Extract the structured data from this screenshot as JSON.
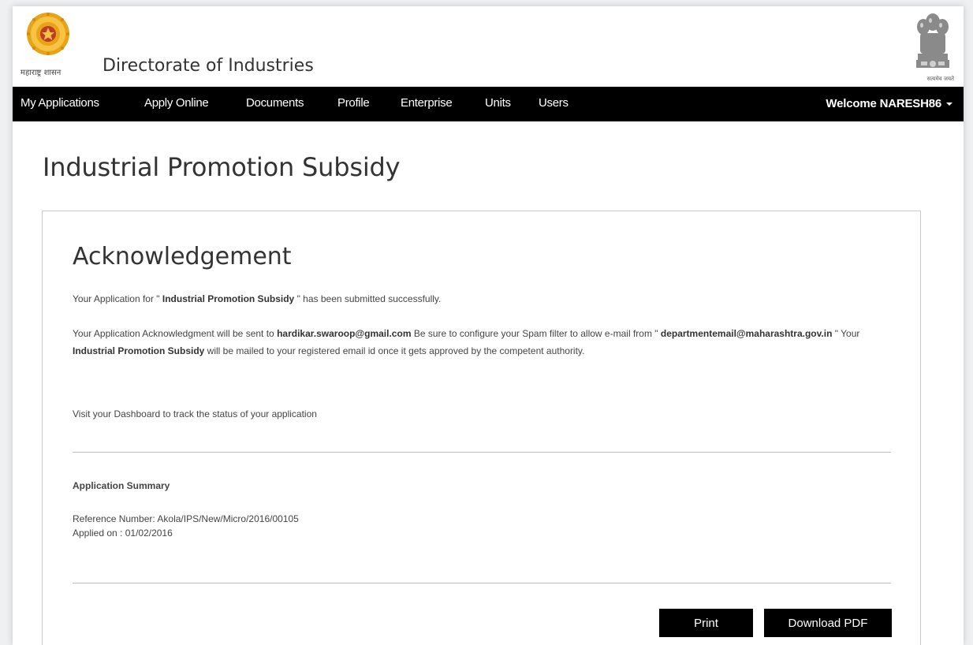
{
  "header": {
    "state_caption": "महाराष्ट्र शासन",
    "site_title": "Directorate of Industries",
    "emblem_caption": "सत्यमेव जयते"
  },
  "nav": {
    "items": [
      {
        "label": "My Applications"
      },
      {
        "label": "Apply Online"
      },
      {
        "label": "Documents"
      },
      {
        "label": "Profile"
      },
      {
        "label": "Enterprise"
      },
      {
        "label": "Units"
      },
      {
        "label": "Users"
      }
    ],
    "welcome": "Welcome NARESH86"
  },
  "page": {
    "heading": "Industrial Promotion Subsidy"
  },
  "ack": {
    "title": "Acknowledgement",
    "p1_pre": "Your Application for \" ",
    "p1_bold": "Industrial Promotion Subsidy",
    "p1_post": " \" has been submitted successfully.",
    "p2_a": "Your Application Acknowledgment will be sent to ",
    "p2_email": "hardikar.swaroop@gmail.com",
    "p2_b": " Be sure to configure your Spam filter to allow   e-mail from \" ",
    "p2_dept_email": "departmentemail@maharashtra.gov.in",
    "p2_c": " \" Your ",
    "p2_bold2": "Industrial Promotion Subsidy",
    "p2_d": " will be mailed to your registered email id once it gets approved by the competent authority.",
    "p3": "Visit your Dashboard to track the status of your application"
  },
  "summary": {
    "heading": "Application Summary",
    "reference_line": "Reference Number: Akola/IPS/New/Micro/2016/00105",
    "applied_line": "Applied on : 01/02/2016"
  },
  "buttons": {
    "print": "Print",
    "download": "Download PDF"
  },
  "colors": {
    "navbar": "#000000",
    "logo_gold": "#e8a317",
    "logo_red": "#c0392b"
  }
}
